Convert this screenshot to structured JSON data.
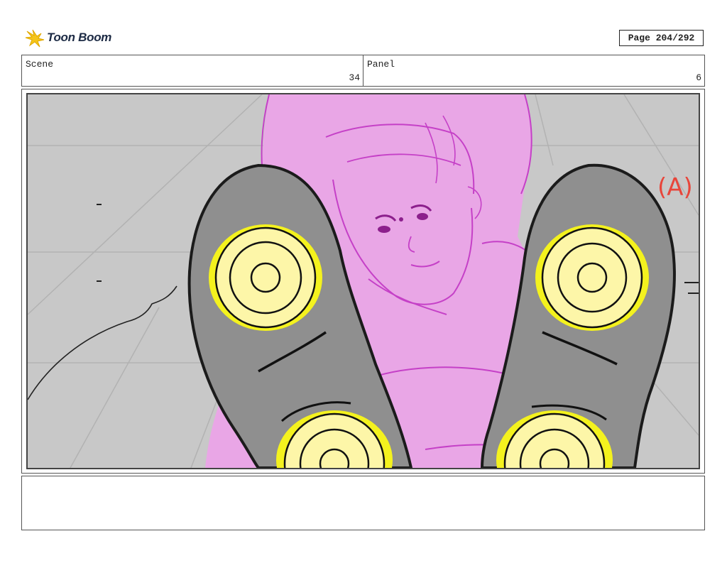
{
  "header": {
    "logo_text": "Toon Boom",
    "page_label": "Page 204/292"
  },
  "info": {
    "scene_label": "Scene",
    "scene_value": "34",
    "panel_label": "Panel",
    "panel_value": "6"
  },
  "panel": {
    "annotation": "(A)",
    "colors": {
      "background": "#c8c8c8",
      "character": "#e9a6e6",
      "character_line": "#c540c7",
      "shoe_sole": "#8f8f8f",
      "target_glow": "#f4f21e",
      "target_fill": "#fdf6a8",
      "annotation": "#e8453a"
    }
  },
  "notes": {
    "text": ""
  }
}
